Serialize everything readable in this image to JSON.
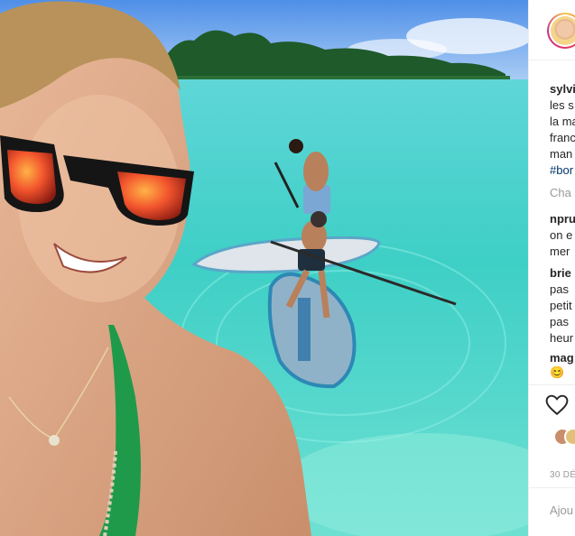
{
  "post": {
    "author": "sylvi",
    "caption_lines": [
      "les s",
      "la ma",
      "franc",
      "man"
    ],
    "hashtag": "#bor"
  },
  "comments_link": "Cha",
  "comments": [
    {
      "user": "npru",
      "lines": [
        "on e",
        "mer"
      ]
    },
    {
      "user": "brie",
      "lines": [
        "pas",
        "petit",
        "pas",
        "heur"
      ]
    },
    {
      "user": "mag",
      "emoji": "😊"
    }
  ],
  "date": "30 DÉ",
  "add_comment_placeholder": "Ajou",
  "icons": {
    "like": "heart-icon",
    "avatar": "profile-avatar"
  },
  "colors": {
    "text": "#262626",
    "muted": "#999999",
    "link": "#003569",
    "lagoon": "#3fd2c6"
  }
}
